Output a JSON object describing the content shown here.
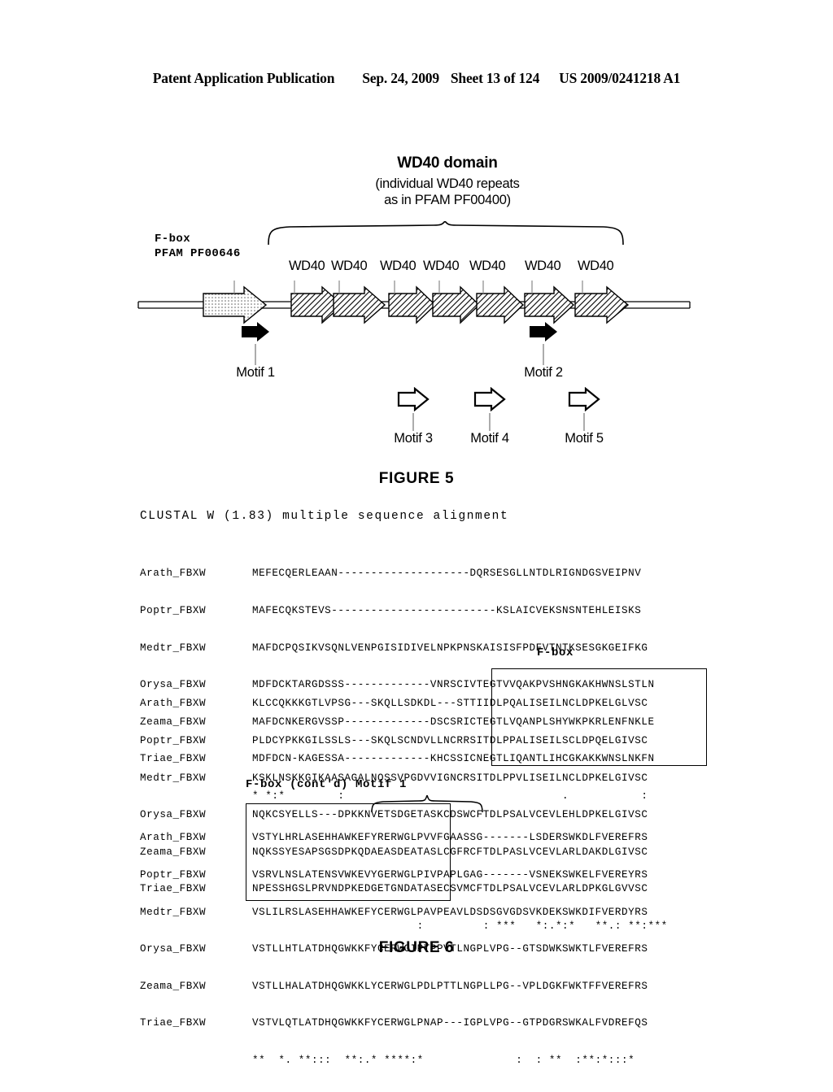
{
  "header": {
    "publication": "Patent Application Publication",
    "date": "Sep. 24, 2009",
    "sheet": "Sheet 13 of 124",
    "patent_number": "US 2009/0241218 A1"
  },
  "figure5": {
    "caption": "FIGURE 5",
    "wd40_title": "WD40 domain",
    "wd40_subtitle_line1": "(individual WD40 repeats",
    "wd40_subtitle_line2": "as in PFAM PF00400)",
    "fbox_label_line1": "F-box",
    "fbox_label_line2": "PFAM PF00646",
    "wd40_repeat_labels": [
      "WD40",
      "WD40",
      "WD40",
      "WD40",
      "WD40",
      "WD40",
      "WD40"
    ],
    "motifs_filled": [
      {
        "label": "Motif 1"
      },
      {
        "label": "Motif 2"
      }
    ],
    "motifs_hollow": [
      {
        "label": "Motif 3"
      },
      {
        "label": "Motif 4"
      },
      {
        "label": "Motif 5"
      }
    ]
  },
  "figure6": {
    "caption": "FIGURE 6",
    "clustal_title": "CLUSTAL W (1.83) multiple sequence alignment",
    "annotations": {
      "fbox": "F-box",
      "fbox_contd_motif1": "F-box (cont'd) Motif 1"
    },
    "blocks": [
      {
        "rows": [
          {
            "name": "Arath_FBXW",
            "seq": "MEFECQERLEAAN--------------------DQRSESGLLNTDLRIGNDGSVEIPNV"
          },
          {
            "name": "Poptr_FBXW",
            "seq": "MAFECQKSTEVS-------------------------KSLAICVEKSNSNTEHLEISKS"
          },
          {
            "name": "Medtr_FBXW",
            "seq": "MAFDCPQSIKVSQNLVENPGISIDIVELNPKPNSKAISISFPDFVTNTKSESGKGEIFKG"
          },
          {
            "name": "Orysa_FBXW",
            "seq": "MDFDCKTARGDSSS-------------VNRSCIVTEGTVVQAKPVSHNGKAKHWNSLSTLN"
          },
          {
            "name": "Zeama_FBXW",
            "seq": "MAFDCNKERGVSSP-------------DSCSRICTEGTLVQANPLSHYWKPKRLENFNKLE"
          },
          {
            "name": "Triae_FBXW",
            "seq": "MDFDCN-KAGESSA-------------KHCSSICNEGTLIQANTLIHCGKAKKWNSLNKFN"
          }
        ],
        "consensus": "* *:*        :                                 .           :"
      },
      {
        "rows": [
          {
            "name": "Arath_FBXW",
            "seq": "KLCCQKKKGTLVPSG---SKQLLSDKDL---STTIIDLPQALISEILNCLDPKELGLVSC"
          },
          {
            "name": "Poptr_FBXW",
            "seq": "PLDCYPKKGILSSLS---SKQLSCNDVLLNCRRSITDLPPALISEILSCLDPQELGIVSC"
          },
          {
            "name": "Medtr_FBXW",
            "seq": "KSKLNSKKGIKAASAGALNQSSVPGDVVIGNCRSITDLPPVLISEILNCLDPKELGIVSC"
          },
          {
            "name": "Orysa_FBXW",
            "seq": "NQKCSYELLS---DPKKNVETSDGETASKCDSWCFTDLPSALVCEVLEHLDPKELGIVSC"
          },
          {
            "name": "Zeama_FBXW",
            "seq": "NQKSSYESAPSGSDPKQDAEASDEATASLCGFRCFTDLPASLVCEVLARLDAKDLGIVSC"
          },
          {
            "name": "Triae_FBXW",
            "seq": "NPESSHGSLPRVNDPKEDGETGNDATASECSVMCFTDLPSALVCEVLARLDPKGLGVVSC"
          }
        ],
        "consensus": "                         :         : ***   *:.*:*   **.: **:***"
      },
      {
        "rows": [
          {
            "name": "Arath_FBXW",
            "seq": "VSTYLHRLASEHHAWKEFYRERWGLPVVFGAASSG-------LSDERSWKDLFVEREFRS"
          },
          {
            "name": "Poptr_FBXW",
            "seq": "VSRVLNSLATENSVWKEVYGERWGLPIVPAPLGAG-------VSNEKSWKELFVEREYRS"
          },
          {
            "name": "Medtr_FBXW",
            "seq": "VSLILRSLASEHHAWKEFYCERWGLPAVPEAVLDSDSGVGDSVKDEKSWKDIFVERDYRS"
          },
          {
            "name": "Orysa_FBXW",
            "seq": "VSTLLHTLATDHQGWKKFYCERWGIPTPPVTLNGPLVPG--GTSDWKSWKTLFVEREFRS"
          },
          {
            "name": "Zeama_FBXW",
            "seq": "VSTLLHALATDHQGWKKLYCERWGLPDLPTTLNGPLLPG--VPLDGKFWKTFFVEREFRS"
          },
          {
            "name": "Triae_FBXW",
            "seq": "VSTVLQTLATDHQGWKKFYCERWGLPNAP---IGPLVPG--GTPDGRSWKALFVDREFQS"
          }
        ],
        "consensus": "**  *. **:::  **:.* ****:*              :  : **  :**:*:::*"
      }
    ]
  }
}
